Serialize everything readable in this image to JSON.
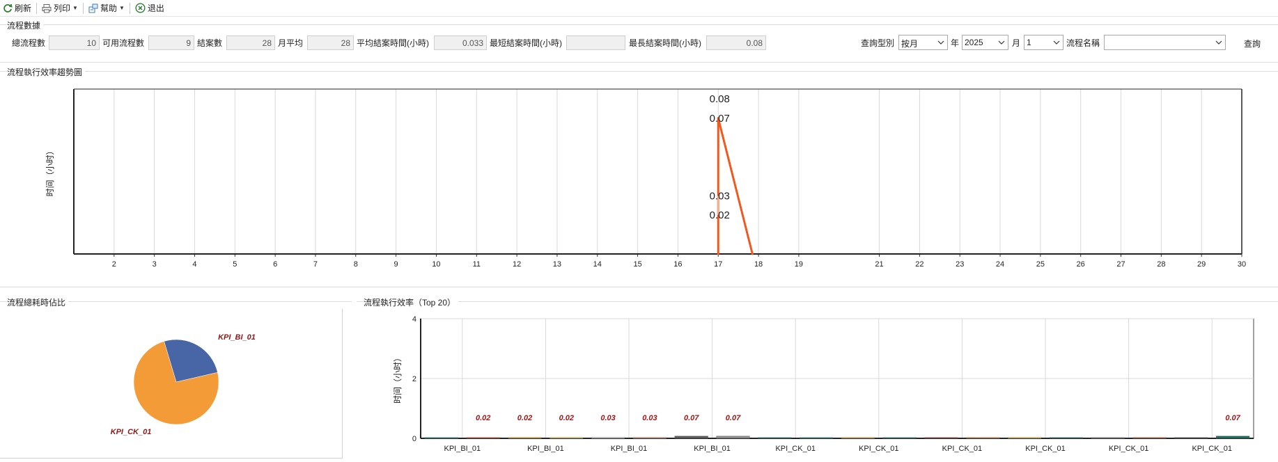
{
  "toolbar": {
    "refresh_label": "刷新",
    "print_label": "列印",
    "help_label": "幫助",
    "exit_label": "退出"
  },
  "stats": {
    "title": "流程數據",
    "total_flows_label": "總流程數",
    "total_flows_value": "10",
    "available_flows_label": "可用流程數",
    "available_flows_value": "9",
    "closed_cases_label": "結案數",
    "closed_cases_value": "28",
    "monthly_avg_label": "月平均",
    "monthly_avg_value": "28",
    "avg_close_time_label": "平均結案時間(小時)",
    "avg_close_time_value": "0.033",
    "min_close_time_label": "最短結案時間(小時)",
    "min_close_time_value": "",
    "max_close_time_label": "最長結案時間(小時)",
    "max_close_time_value": "0.08"
  },
  "query": {
    "type_label": "查詢型別",
    "type_value": "按月",
    "year_value": "2025",
    "year_label": "年",
    "month_value": "1",
    "month_label": "月",
    "flow_name_label": "流程名稱",
    "flow_name_value": "",
    "query_button": "查詢"
  },
  "trend": {
    "title": "流程執行效率趨勢圖"
  },
  "pie_panel": {
    "title": "流程總耗時佔比"
  },
  "bar_panel": {
    "title": "流程執行效率（Top 20）"
  },
  "chart_data": [
    {
      "type": "line",
      "title": "",
      "xlabel": "",
      "ylabel": "时间（小时）",
      "x_ticks": [
        2,
        3,
        4,
        5,
        6,
        7,
        8,
        9,
        10,
        11,
        12,
        13,
        14,
        15,
        16,
        17,
        18,
        19,
        21,
        22,
        23,
        24,
        25,
        26,
        27,
        28,
        29,
        30
      ],
      "xlim": [
        1,
        30
      ],
      "ylim": [
        0,
        0.08
      ],
      "series": [
        {
          "color": "#f0581e",
          "points": [
            [
              17,
              0
            ],
            [
              17,
              0.07
            ],
            [
              17.85,
              0
            ]
          ]
        }
      ],
      "annotations": [
        {
          "x": 17,
          "y": 0.08,
          "text": "0.08"
        },
        {
          "x": 17,
          "y": 0.07,
          "text": "0.07"
        },
        {
          "x": 17,
          "y": 0.03,
          "text": "0.03"
        },
        {
          "x": 17,
          "y": 0.02,
          "text": "0.02"
        }
      ],
      "grid": "vertical"
    },
    {
      "type": "pie",
      "slices": [
        {
          "label": "KPI_BI_01",
          "value": 26,
          "color": "#4866a6"
        },
        {
          "label": "KPI_CK_01",
          "value": 74,
          "color": "#f39c37"
        }
      ]
    },
    {
      "type": "bar",
      "ylabel": "时间（小时）",
      "ylim": [
        0,
        4
      ],
      "y_ticks": [
        0,
        2,
        4
      ],
      "categories": [
        "KPI_BI_01",
        "KPI_BI_01",
        "KPI_BI_01",
        "KPI_BI_01",
        "KPI_BI_01",
        "KPI_BI_01",
        "KPI_BI_01",
        "KPI_CK_01",
        "KPI_CK_01",
        "KPI_CK_01",
        "KPI_CK_01",
        "KPI_CK_01",
        "KPI_CK_01",
        "KPI_CK_01",
        "KPI_CK_01",
        "KPI_CK_01",
        "KPI_CK_01",
        "KPI_CK_01",
        "KPI_CK_01",
        "KPI_CK_01"
      ],
      "x_tick_labels": [
        "KPI_BI_01",
        "KPI_BI_01",
        "KPI_BI_01",
        "KPI_BI_01",
        "KPI_CK_01",
        "KPI_CK_01",
        "KPI_CK_01",
        "KPI_CK_01",
        "KPI_CK_01",
        "KPI_CK_01"
      ],
      "values": [
        0.01,
        0.02,
        0.02,
        0.02,
        0.03,
        0.03,
        0.07,
        0.07,
        0.01,
        0.01,
        0.01,
        0.01,
        0.01,
        0.01,
        0.01,
        0.01,
        0.01,
        0.01,
        0.01,
        0.07
      ],
      "labels": [
        "",
        "0.02",
        "0.02",
        "0.02",
        "0.03",
        "0.03",
        "0.07",
        "0.07",
        "",
        "",
        "",
        "",
        "",
        "",
        "",
        "",
        "",
        "",
        "",
        "0.07"
      ],
      "colors": [
        "#2a7f7f",
        "#b8492a",
        "#d69b2b",
        "#d8c85a",
        "#c0c0c0",
        "#c89a7a",
        "#5a5a5a",
        "#8a8a8a",
        "#2a6d6d",
        "#2a8080",
        "#d4a94a",
        "#2f6f6f",
        "#8b3a3a",
        "#c87a3a",
        "#d4b84a",
        "#2a6060",
        "#7a7a7a",
        "#b05a3a",
        "#4a4a4a",
        "#1f6b5a"
      ],
      "grid": "both"
    }
  ]
}
